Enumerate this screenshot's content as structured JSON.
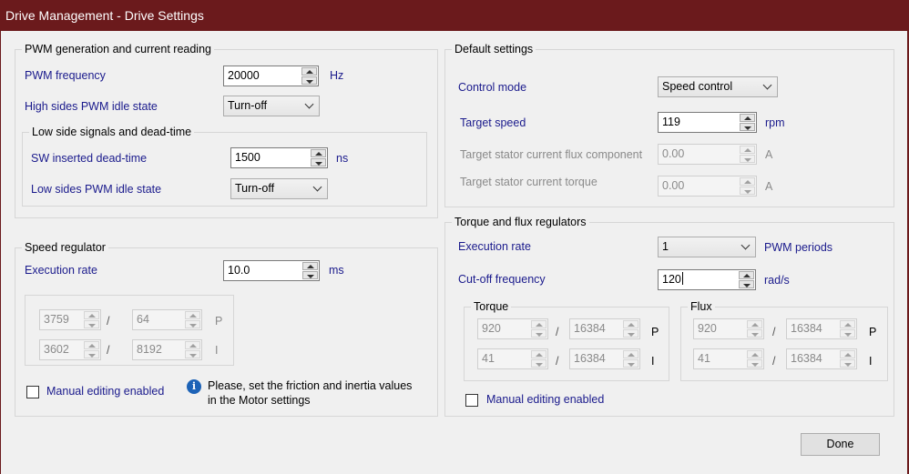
{
  "window": {
    "title": "Drive Management - Drive Settings"
  },
  "pwm": {
    "legend": "PWM generation and current reading",
    "freq_label": "PWM frequency",
    "freq_value": "20000",
    "freq_unit": "Hz",
    "high_label": "High sides PWM idle state",
    "high_value": "Turn-off",
    "low_group": {
      "legend": "Low side signals and dead-time",
      "dead_label": "SW inserted dead-time",
      "dead_value": "1500",
      "dead_unit": "ns",
      "low_label": "Low sides PWM idle state",
      "low_value": "Turn-off"
    }
  },
  "speed_reg": {
    "legend": "Speed regulator",
    "rate_label": "Execution rate",
    "rate_value": "10.0",
    "rate_unit": "ms",
    "p_num": "3759",
    "p_den": "64",
    "p_label": "P",
    "i_num": "3602",
    "i_den": "8192",
    "i_label": "I",
    "slash": "/",
    "manual_label": "Manual editing enabled",
    "note_line1": "Please, set the friction and inertia values",
    "note_line2": "in the Motor settings"
  },
  "defaults": {
    "legend": "Default settings",
    "mode_label": "Control mode",
    "mode_value": "Speed control",
    "speed_label": "Target speed",
    "speed_value": "119",
    "speed_unit": "rpm",
    "flux_label": "Target stator current flux component",
    "flux_value": "0.00",
    "flux_unit": "A",
    "torque_label": "Target stator current torque",
    "torque_value": "0.00",
    "torque_unit": "A"
  },
  "tf_reg": {
    "legend": "Torque and flux regulators",
    "rate_label": "Execution rate",
    "rate_value": "1",
    "rate_unit": "PWM periods",
    "cutoff_label": "Cut-off frequency",
    "cutoff_value": "120",
    "cutoff_unit": "rad/s",
    "torque": {
      "legend": "Torque",
      "p_num": "920",
      "p_den": "16384",
      "i_num": "41",
      "i_den": "16384"
    },
    "flux": {
      "legend": "Flux",
      "p_num": "920",
      "p_den": "16384",
      "i_num": "41",
      "i_den": "16384"
    },
    "p_label": "P",
    "i_label": "I",
    "slash": "/",
    "manual_label": "Manual editing enabled"
  },
  "footer": {
    "done_label": "Done"
  }
}
